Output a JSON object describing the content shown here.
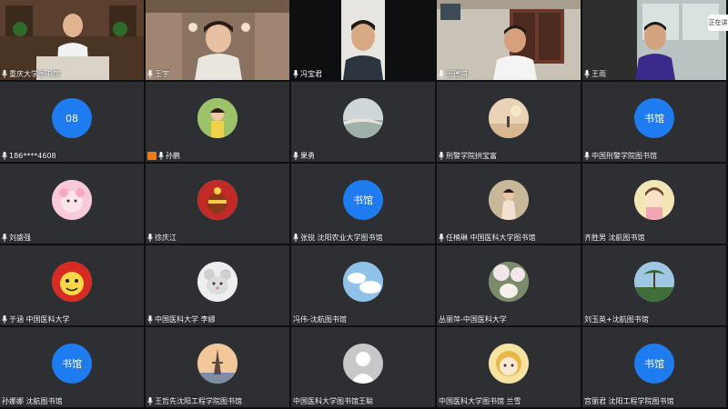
{
  "side_button_label": "正在讲",
  "row1": [
    {
      "name": "重庆大学图书馆"
    },
    {
      "name": "王宇"
    },
    {
      "name": "冯宝君"
    },
    {
      "name": "王德甫"
    },
    {
      "name": "王雨"
    }
  ],
  "row2": [
    {
      "name": "186****4608",
      "avatar_text": "08"
    },
    {
      "name": "孙鹏"
    },
    {
      "name": "果勇"
    },
    {
      "name": "刑警学院拱宝富"
    },
    {
      "name": "中国刑警学院图书馆",
      "avatar_text": "书馆"
    }
  ],
  "row3": [
    {
      "name": "刘盛强"
    },
    {
      "name": "徐庆江"
    },
    {
      "name": "张锐 沈阳农业大学图书馆",
      "avatar_text": "书馆"
    },
    {
      "name": "任楠琳 中国医科大学图书馆"
    },
    {
      "name": "齐胜男 沈航图书馆"
    }
  ],
  "row4": [
    {
      "name": "于涵 中国医科大学"
    },
    {
      "name": "中国医科大学 李娜"
    },
    {
      "name": "冯伟-沈航图书馆"
    },
    {
      "name": "丛丽萍-中国医科大学"
    },
    {
      "name": "刘玉英+沈航图书馆"
    }
  ],
  "row5": [
    {
      "name": "孙娜娜 沈航图书馆",
      "avatar_text": "书馆"
    },
    {
      "name": "王哲先沈阳工程学院图书馆"
    },
    {
      "name": "中国医科大学图书馆王聪"
    },
    {
      "name": "中国医科大学图书馆 兰雪"
    },
    {
      "name": "宫丽君 沈阳工程学院图书馆",
      "avatar_text": "书馆"
    }
  ]
}
